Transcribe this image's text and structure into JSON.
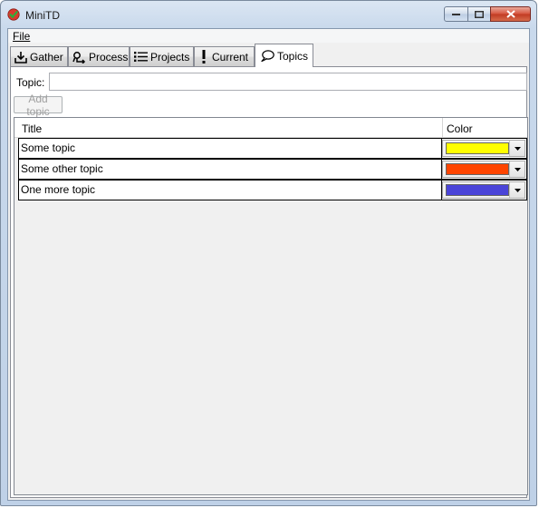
{
  "window": {
    "title": "MiniTD",
    "menu": {
      "file": "File"
    }
  },
  "tabs": [
    {
      "label": "Gather",
      "icon": "download-icon"
    },
    {
      "label": "Process",
      "icon": "process-icon"
    },
    {
      "label": "Projects",
      "icon": "list-icon"
    },
    {
      "label": "Current",
      "icon": "exclamation-icon"
    },
    {
      "label": "Topics",
      "icon": "speech-bubble-icon",
      "active": true
    }
  ],
  "topics_panel": {
    "topic_label": "Topic:",
    "topic_value": "",
    "add_button": "Add topic",
    "columns": {
      "title": "Title",
      "color": "Color"
    },
    "rows": [
      {
        "title": "Some topic",
        "color": "#ffff00"
      },
      {
        "title": "Some other topic",
        "color": "#ff4500"
      },
      {
        "title": "One more topic",
        "color": "#4a44d8"
      }
    ]
  }
}
